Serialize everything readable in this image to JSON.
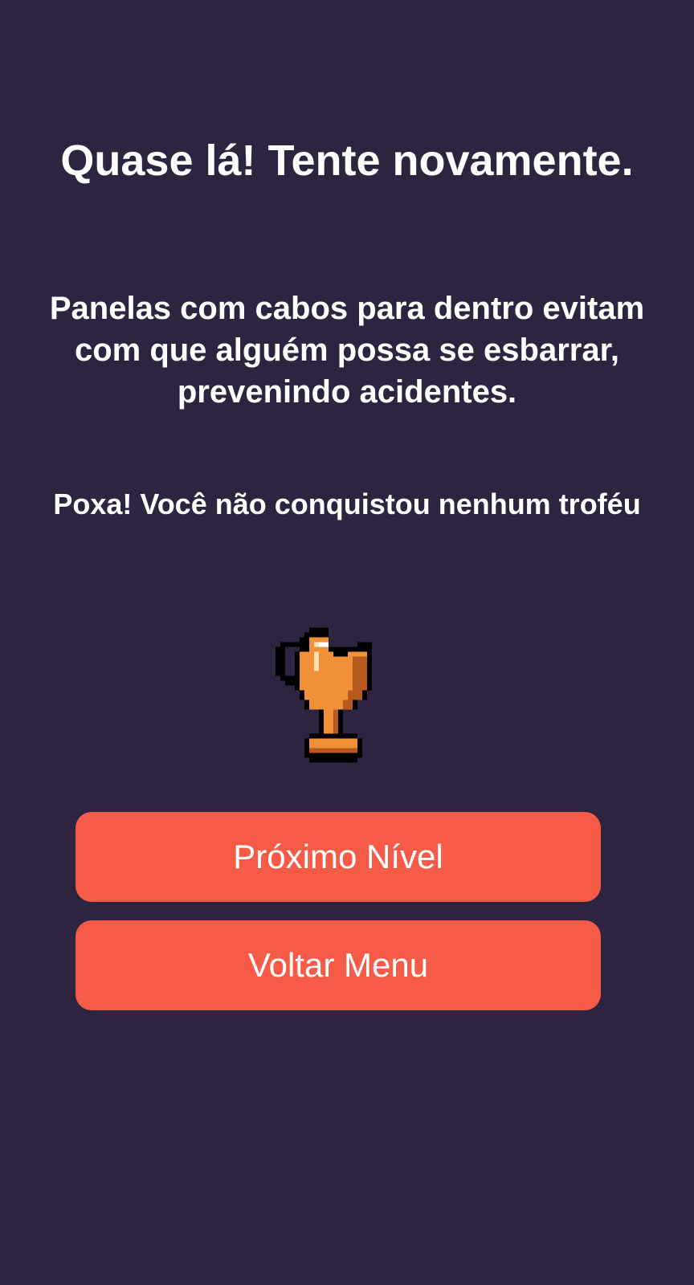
{
  "screen": {
    "title": "Quase lá! Tente novamente.",
    "tip": "Panelas com cabos para dentro evitam com que alguém possa se esbarrar, prevenindo acidentes.",
    "result_message": "Poxa! Você não conquistou nenhum troféu"
  },
  "trophy": {
    "icon": "bronze-trophy-icon"
  },
  "buttons": {
    "next_level_label": "Próximo Nível",
    "back_menu_label": "Voltar Menu"
  },
  "colors": {
    "background": "#2d2440",
    "button": "#f65b47",
    "text": "#ffffff",
    "trophy_main": "#f0913a",
    "trophy_shadow": "#b85a1f",
    "trophy_highlight": "#ffe0b0",
    "trophy_outline": "#000000"
  }
}
